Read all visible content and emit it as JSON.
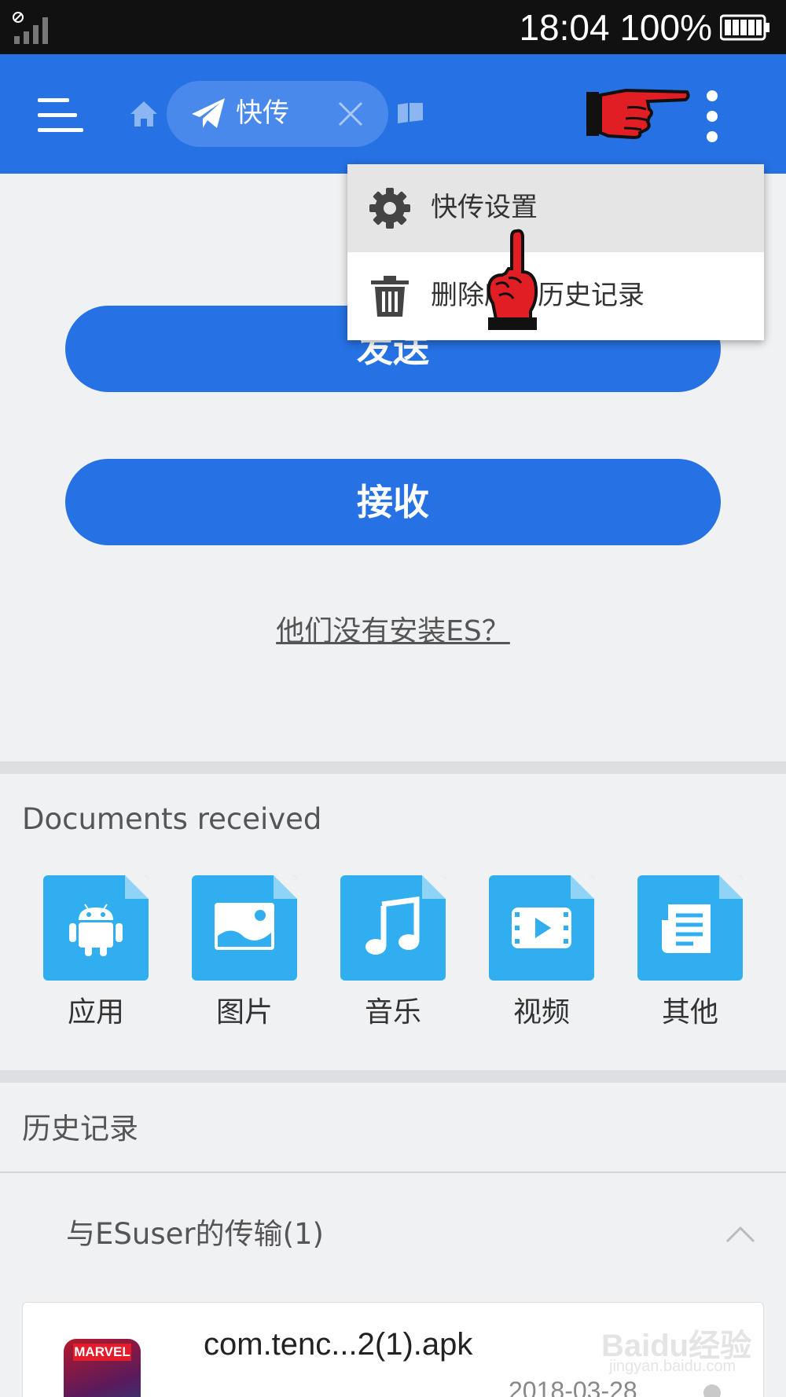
{
  "status_bar": {
    "time": "18:04",
    "battery": "100%"
  },
  "app_bar": {
    "tab_label": "快传"
  },
  "menu": {
    "items": [
      {
        "label": "快传设置",
        "icon": "gear-icon"
      },
      {
        "label": "删除所有历史记录",
        "icon": "trash-icon"
      }
    ]
  },
  "main": {
    "send_label": "发送",
    "receive_label": "接收",
    "no_es_link": "他们没有安装ES？"
  },
  "documents": {
    "title": "Documents received",
    "categories": [
      {
        "label": "应用",
        "icon": "android-icon"
      },
      {
        "label": "图片",
        "icon": "image-icon"
      },
      {
        "label": "音乐",
        "icon": "music-icon"
      },
      {
        "label": "视频",
        "icon": "video-icon"
      },
      {
        "label": "其他",
        "icon": "document-icon"
      }
    ]
  },
  "history": {
    "title": "历史记录",
    "group_title": "与ESuser的传输(1)",
    "files": [
      {
        "name": "com.tenc...2(1).apk",
        "date": "2018-03-28",
        "thumb_text": "MARVEL"
      }
    ]
  },
  "watermark": {
    "text": "Baidu经验",
    "sub": "jingyan.baidu.com"
  },
  "colors": {
    "accent": "#2671e3",
    "tile": "#31aef0",
    "status_bar": "#111111"
  }
}
